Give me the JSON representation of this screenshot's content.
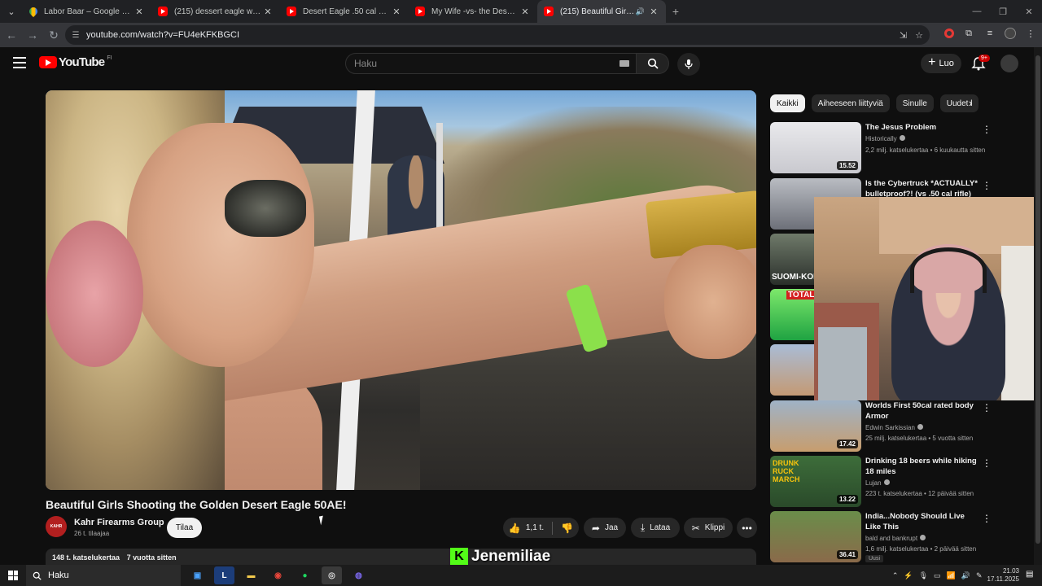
{
  "browser": {
    "tabs": [
      {
        "label": "Labor Baar – Google Maps",
        "icon": "maps-icon",
        "active": false
      },
      {
        "label": "(215) dessert eagle woman - YouTube",
        "icon": "youtube-icon",
        "active": false
      },
      {
        "label": "Desert Eagle .50 cal & woman s",
        "icon": "youtube-icon",
        "active": false
      },
      {
        "label": "My Wife -vs- the Desert Eagle",
        "icon": "youtube-icon",
        "active": false
      },
      {
        "label": "(215) Beautiful Girls Shooting the Golden Desert Eagle 50AE!",
        "icon": "youtube-icon",
        "active": true
      }
    ],
    "url": "youtube.com/watch?v=FU4eKFKBGCI"
  },
  "youtube": {
    "logo_text": "YouTube",
    "country_code": "FI",
    "search_placeholder": "Haku",
    "create_label": "Luo",
    "notification_count": "9+"
  },
  "video": {
    "title": "Beautiful Girls Shooting the Golden Desert Eagle 50AE!",
    "channel": "Kahr Firearms Group",
    "channel_avatar_text": "KAHR",
    "subscribers": "26 t. tilaajaa",
    "subscribe_label": "Tilaa",
    "likes": "1,1 t.",
    "share_label": "Jaa",
    "download_label": "Lataa",
    "clip_label": "Klippi",
    "views": "148 t. katselukertaa",
    "age": "7 vuotta sitten"
  },
  "chips": [
    "Kaikki",
    "Aiheeseen liittyviä",
    "Sinulle",
    "Uudet l"
  ],
  "recommendations": [
    {
      "title": "The Jesus Problem",
      "channel": "Historically",
      "meta": "2,2 milj. katselukertaa • 6 kuukautta sitten",
      "duration": "15.52",
      "verified": true
    },
    {
      "title": "Is the Cybertruck *ACTUALLY* bulletproof?! (vs .50 cal rifle)",
      "channel": "",
      "meta": "",
      "duration": "",
      "verified": false
    },
    {
      "title": "",
      "channel": "",
      "meta": "",
      "duration": "",
      "thumb_text": "SUOMI-KOI"
    },
    {
      "title": "",
      "channel": "",
      "meta": "",
      "duration": "",
      "thumb_text": "TOTAL"
    },
    {
      "title": "",
      "channel": "",
      "meta": "",
      "duration": ""
    },
    {
      "title": "Worlds First 50cal rated body Armor",
      "channel": "Edwin Sarkissian",
      "meta": "25 milj. katselukertaa • 5 vuotta sitten",
      "duration": "17.42",
      "verified": true
    },
    {
      "title": "Drinking 18 beers while hiking 18 miles",
      "channel": "Lujan",
      "meta": "223 t. katselukertaa • 12 päivää sitten",
      "duration": "13.22",
      "verified": true,
      "thumb_text": "DRUNK RUCK MARCH"
    },
    {
      "title": "India...Nobody Should Live Like This",
      "channel": "bald and bankrupt",
      "meta": "1,6 milj. katselukertaa • 2 päivää sitten",
      "duration": "36.41",
      "verified": true,
      "badge": "Uusi"
    }
  ],
  "overlay": {
    "streamer_name": "Jenemiliae",
    "streamer_logo": "K"
  },
  "taskbar": {
    "search_label": "Haku",
    "time": "21.03",
    "date": "17.11.2025"
  }
}
